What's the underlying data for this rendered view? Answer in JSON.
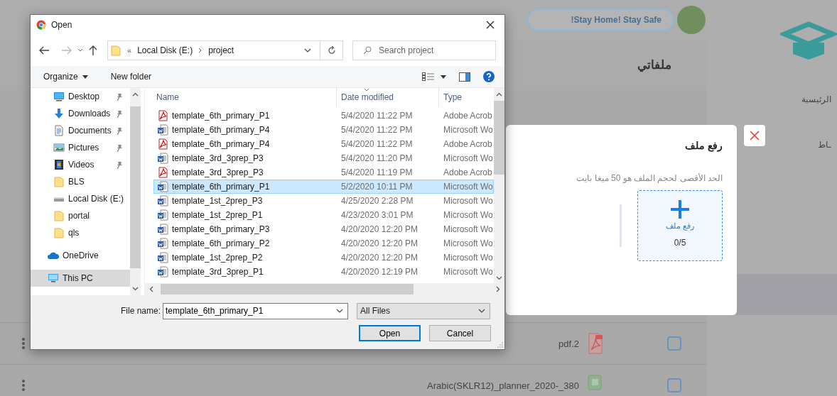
{
  "background_page": {
    "banner": "!Stay Home! Stay Safe",
    "page_title": "ملفاتي",
    "sidebar_items": [
      {
        "label": "الرئيسية",
        "selected": false
      },
      {
        "label": "ـاط",
        "selected": false
      },
      {
        "selected": true
      }
    ],
    "rows": [
      {
        "name": "pdf.2",
        "kind": "pdf",
        "checked": false
      },
      {
        "name": "Arabic(SKLR12)_planner_2020-_380",
        "kind": "sheet",
        "checked": false
      }
    ]
  },
  "upload_modal": {
    "title": "رفع ملف",
    "hint": "الحد الأقصى لحجم الملف هو 50 ميغا بايت",
    "dropzone_label": "رفع ملف",
    "count": "0/5"
  },
  "open_dialog": {
    "title": "Open",
    "breadcrumb_overflow": "«",
    "breadcrumb": [
      "Local Disk (E:)",
      "project"
    ],
    "search": {
      "placeholder": "Search project"
    },
    "commands": [
      "Organize",
      "New folder"
    ],
    "nav": {
      "quick_access": [
        {
          "label": "Desktop",
          "kind": "desktop",
          "pinned": true,
          "selected": false
        },
        {
          "label": "Downloads",
          "kind": "downloads",
          "pinned": true,
          "selected": false
        },
        {
          "label": "Documents",
          "kind": "documents",
          "pinned": true,
          "selected": false
        },
        {
          "label": "Pictures",
          "kind": "pictures",
          "pinned": true,
          "selected": false
        },
        {
          "label": "Videos",
          "kind": "videos",
          "pinned": true,
          "selected": false
        },
        {
          "label": "BLS",
          "kind": "folder",
          "pinned": false,
          "selected": false
        },
        {
          "label": "Local Disk (E:)",
          "kind": "drive",
          "pinned": false,
          "selected": false
        },
        {
          "label": "portal",
          "kind": "folder",
          "pinned": false,
          "selected": false
        },
        {
          "label": "qls",
          "kind": "folder",
          "pinned": false,
          "selected": false
        }
      ],
      "locations": [
        {
          "label": "OneDrive",
          "kind": "onedrive",
          "selected": false
        },
        {
          "label": "This PC",
          "kind": "pc",
          "selected": true
        }
      ]
    },
    "columns": [
      "Name",
      "Date modified",
      "Type"
    ],
    "files": [
      {
        "name": "template_6th_primary_P1",
        "date": "5/4/2020 11:22 PM",
        "type": "Adobe Acrob",
        "kind": "pdf",
        "selected": false
      },
      {
        "name": "template_6th_primary_P4",
        "date": "5/4/2020 11:22 PM",
        "type": "Microsoft Wo",
        "kind": "word",
        "selected": false
      },
      {
        "name": "template_6th_primary_P4",
        "date": "5/4/2020 11:22 PM",
        "type": "Adobe Acrob",
        "kind": "pdf",
        "selected": false
      },
      {
        "name": "template_3rd_3prep_P3",
        "date": "5/4/2020 11:20 PM",
        "type": "Microsoft Wo",
        "kind": "word",
        "selected": false
      },
      {
        "name": "template_3rd_3prep_P3",
        "date": "5/4/2020 11:19 PM",
        "type": "Adobe Acrob",
        "kind": "pdf",
        "selected": false
      },
      {
        "name": "template_6th_primary_P1",
        "date": "5/2/2020 10:11 PM",
        "type": "Microsoft Wo",
        "kind": "word",
        "selected": true
      },
      {
        "name": "template_1st_2prep_P3",
        "date": "4/25/2020 2:28 PM",
        "type": "Microsoft Wo",
        "kind": "word",
        "selected": false
      },
      {
        "name": "template_1st_2prep_P1",
        "date": "4/23/2020 3:01 PM",
        "type": "Microsoft Wo",
        "kind": "word",
        "selected": false
      },
      {
        "name": "template_6th_primary_P3",
        "date": "4/20/2020 12:20 PM",
        "type": "Microsoft Wo",
        "kind": "word",
        "selected": false
      },
      {
        "name": "template_6th_primary_P2",
        "date": "4/20/2020 12:20 PM",
        "type": "Microsoft Wo",
        "kind": "word",
        "selected": false
      },
      {
        "name": "template_1st_2prep_P2",
        "date": "4/20/2020 12:20 PM",
        "type": "Microsoft Wo",
        "kind": "word",
        "selected": false
      },
      {
        "name": "template_3rd_3prep_P1",
        "date": "4/20/2020 12:19 PM",
        "type": "Microsoft Wo",
        "kind": "word",
        "selected": false
      }
    ],
    "file_name_label": "File name:",
    "file_name": "template_6th_primary_P1",
    "filter": "All Files",
    "buttons": [
      {
        "label": "Open",
        "default": true
      },
      {
        "label": "Cancel",
        "default": false
      }
    ]
  }
}
